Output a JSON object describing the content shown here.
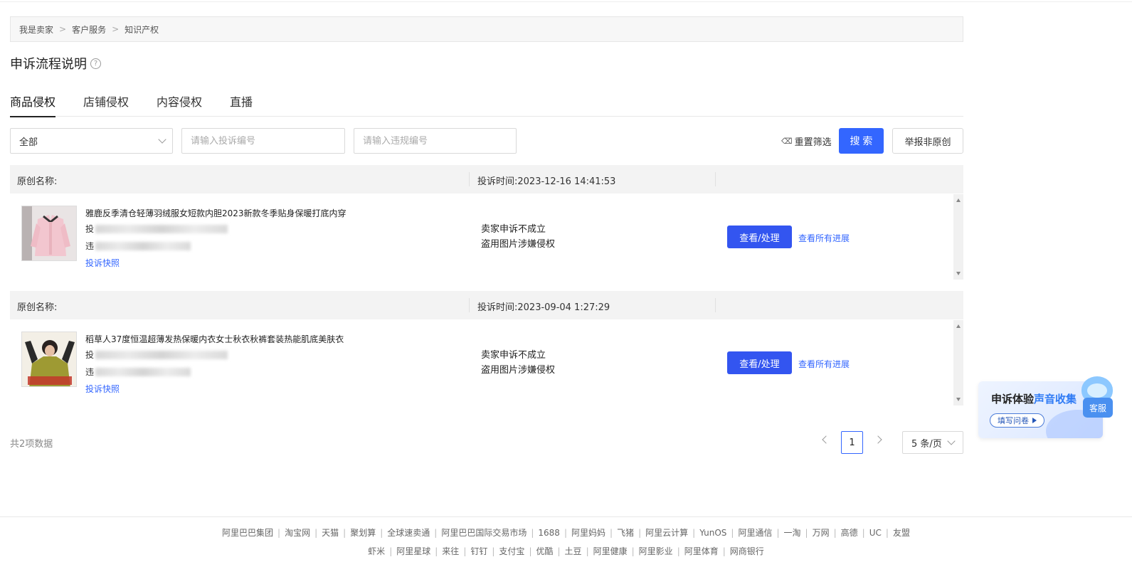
{
  "breadcrumb": [
    "我是卖家",
    "客户服务",
    "知识产权"
  ],
  "breadcrumb_sep": ">",
  "page_title": "申诉流程说明",
  "help_glyph": "?",
  "tabs": [
    {
      "label": "商品侵权",
      "active": true
    },
    {
      "label": "店铺侵权",
      "active": false
    },
    {
      "label": "内容侵权",
      "active": false
    },
    {
      "label": "直播",
      "active": false
    }
  ],
  "filters": {
    "type_select": "全部",
    "complaint_placeholder": "请输入投诉编号",
    "violation_placeholder": "请输入违规编号",
    "reset_label": "重置筛选",
    "search_label": "搜 索",
    "report_label": "举报非原创"
  },
  "records": [
    {
      "original_label": "原创名称:",
      "complaint_time": "投诉时间:2023-12-16 14:41:53",
      "product_name": "雅鹿反季清仓轻薄羽绒服女短款内胆2023新款冬季贴身保暖打底内穿",
      "line1_prefix": "投",
      "line2_prefix": "违",
      "snapshot_label": "投诉快照",
      "status_1": "卖家申诉不成立",
      "status_2": "盗用图片涉嫌侵权",
      "view_label": "查看/处理",
      "progress_label": "查看所有进展"
    },
    {
      "original_label": "原创名称:",
      "complaint_time": "投诉时间:2023-09-04 1:27:29",
      "product_name": "稻草人37度恒温超薄发热保暖内衣女士秋衣秋裤套装热能肌底美肤衣",
      "line1_prefix": "投",
      "line2_prefix": "违",
      "snapshot_label": "投诉快照",
      "status_1": "卖家申诉不成立",
      "status_2": "盗用图片涉嫌侵权",
      "view_label": "查看/处理",
      "progress_label": "查看所有进展"
    }
  ],
  "pagination": {
    "total": "共2项数据",
    "current_page": "1",
    "page_size": "5 条/页"
  },
  "float_card": {
    "title_a": "申诉体验",
    "title_b": "声音收集",
    "button": "填写问卷",
    "accent": "#2f7bf5"
  },
  "kefu_label": "客服",
  "footer": {
    "row1": [
      "阿里巴巴集团",
      "淘宝网",
      "天猫",
      "聚划算",
      "全球速卖通",
      "阿里巴巴国际交易市场",
      "1688",
      "阿里妈妈",
      "飞猪",
      "阿里云计算",
      "YunOS",
      "阿里通信",
      "一淘",
      "万网",
      "高德",
      "UC",
      "友盟"
    ],
    "row2": [
      "虾米",
      "阿里星球",
      "来往",
      "钉钉",
      "支付宝",
      "优酷",
      "土豆",
      "阿里健康",
      "阿里影业",
      "阿里体育",
      "网商银行"
    ]
  },
  "colors": {
    "primary": "#3366ff",
    "button_view": "#3355f0",
    "header_bg": "#f3f3f3"
  }
}
